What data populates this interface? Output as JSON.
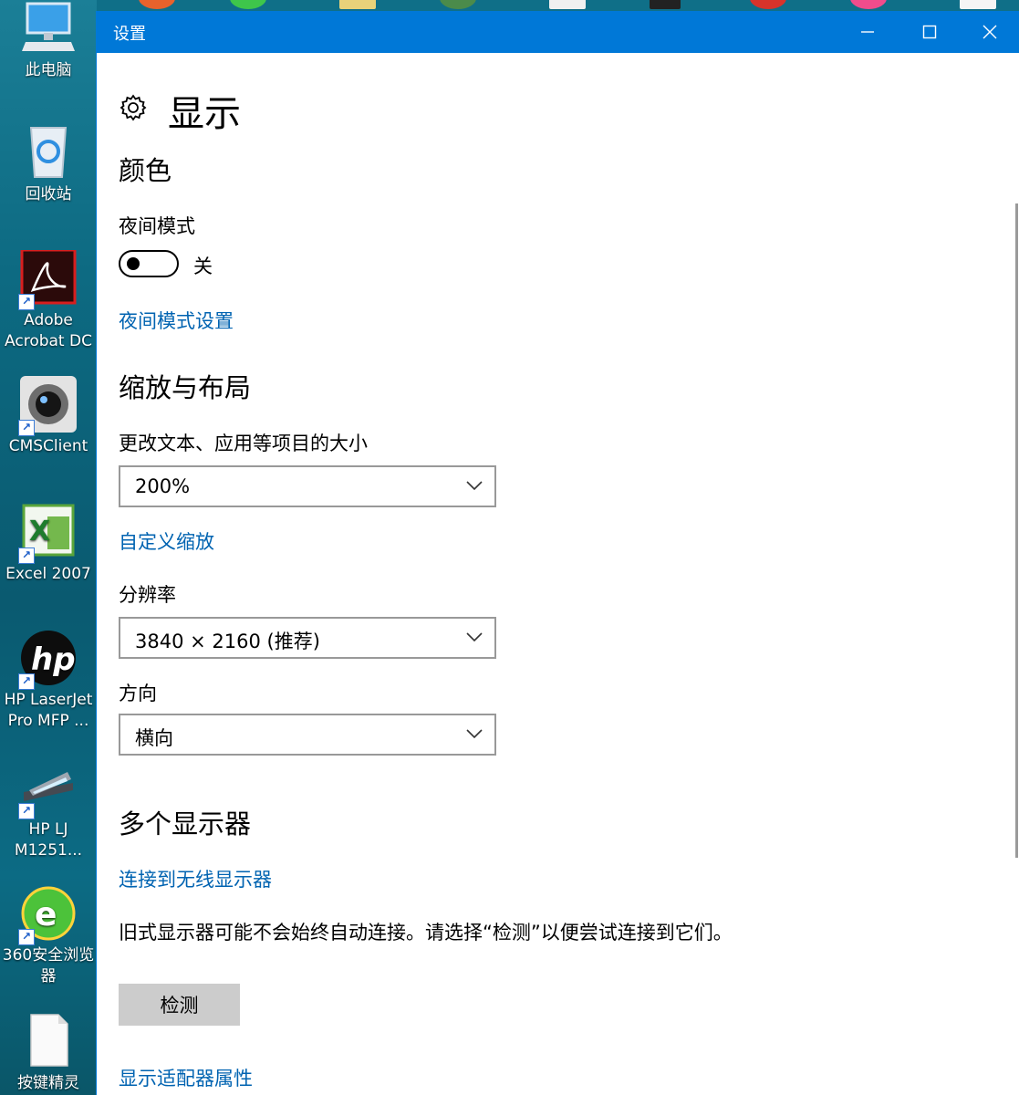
{
  "desktop": {
    "icons": [
      {
        "label": "此电脑",
        "icon": "computer-icon"
      },
      {
        "label": "回收站",
        "icon": "recycle-bin-icon"
      },
      {
        "label": "Adobe Acrobat DC",
        "icon": "acrobat-icon"
      },
      {
        "label": "CMSClient",
        "icon": "webcam-icon"
      },
      {
        "label": "Excel 2007",
        "icon": "excel-icon"
      },
      {
        "label": "HP LaserJet Pro MFP ...",
        "icon": "hp-icon"
      },
      {
        "label": "HP LJ M1251...",
        "icon": "scanner-icon"
      },
      {
        "label": "360安全浏览器",
        "icon": "browser-360-icon"
      },
      {
        "label": "按键精灵",
        "icon": "file-icon"
      }
    ]
  },
  "window": {
    "title": "设置",
    "minimize_glyph": "—",
    "maximize_glyph": "☐",
    "close_glyph": "✕"
  },
  "page": {
    "title": "显示",
    "color_section": {
      "heading": "颜色",
      "night_mode_label": "夜间模式",
      "night_mode_state": "关",
      "night_mode_on": false,
      "night_mode_settings_link": "夜间模式设置"
    },
    "scale_section": {
      "heading": "缩放与布局",
      "size_label": "更改文本、应用等项目的大小",
      "size_value": "200%",
      "custom_scale_link": "自定义缩放",
      "resolution_label": "分辨率",
      "resolution_value": "3840 × 2160 (推荐)",
      "orientation_label": "方向",
      "orientation_value": "横向"
    },
    "multi_display_section": {
      "heading": "多个显示器",
      "wireless_link": "连接到无线显示器",
      "description": "旧式显示器可能不会始终自动连接。请选择“检测”以便尝试连接到它们。",
      "detect_button": "检测",
      "adapter_link": "显示适配器属性"
    }
  },
  "colors": {
    "accent": "#0078d7",
    "link": "#0063b1",
    "button_bg": "#cccccc"
  }
}
